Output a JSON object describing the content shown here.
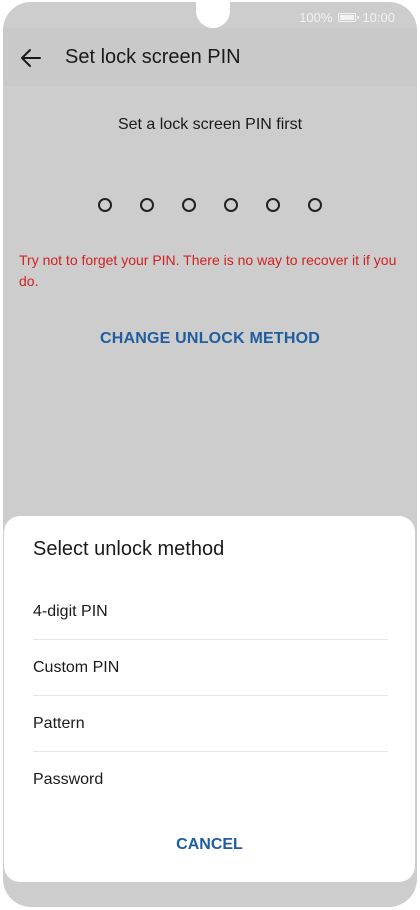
{
  "status_bar": {
    "battery_percent": "100%",
    "battery_level": 1.0,
    "time": "10:00"
  },
  "app_bar": {
    "title": "Set lock screen PIN",
    "back_icon": "arrow-left-icon"
  },
  "pin_screen": {
    "subtitle": "Set a lock screen PIN first",
    "pin_length": 6,
    "warning": "Try not to forget your PIN. There is no way to recover it if you do.",
    "change_method_label": "CHANGE UNLOCK METHOD"
  },
  "unlock_sheet": {
    "title": "Select unlock method",
    "options": [
      {
        "label": "4-digit PIN"
      },
      {
        "label": "Custom PIN"
      },
      {
        "label": "Pattern"
      },
      {
        "label": "Password"
      }
    ],
    "cancel_label": "CANCEL"
  },
  "colors": {
    "accent": "#1f5da0",
    "warning": "#d32020",
    "scrim": "#cdcdcd"
  }
}
